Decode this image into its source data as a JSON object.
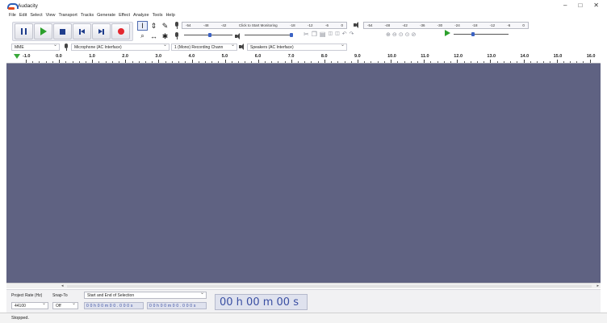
{
  "window": {
    "title": "Audacity",
    "controls": {
      "minimize": "–",
      "maximize": "□",
      "close": "✕"
    }
  },
  "menu": [
    "File",
    "Edit",
    "Select",
    "View",
    "Transport",
    "Tracks",
    "Generate",
    "Effect",
    "Analyze",
    "Tools",
    "Help"
  ],
  "transport": {
    "buttons": [
      "pause-icon",
      "play-icon",
      "stop-icon",
      "skip-to-start-icon",
      "skip-to-end-icon",
      "record-icon"
    ]
  },
  "tools": [
    {
      "name": "selection-tool",
      "glyph": "I"
    },
    {
      "name": "envelope-tool",
      "glyph": "⇕"
    },
    {
      "name": "draw-tool",
      "glyph": "✎"
    },
    {
      "name": "zoom-tool",
      "glyph": "🔍"
    },
    {
      "name": "time-shift-tool",
      "glyph": "↔"
    },
    {
      "name": "multi-tool",
      "glyph": "✱"
    }
  ],
  "record_meter": {
    "ticks": [
      "-54",
      "-48",
      "-42",
      "Click to Start Monitoring",
      "-18",
      "-12",
      "-6",
      "0"
    ]
  },
  "playback_meter": {
    "ticks": [
      "-54",
      "-48",
      "-42",
      "-36",
      "-30",
      "-24",
      "-18",
      "-12",
      "-6",
      "0"
    ]
  },
  "edit_toolbar": [
    "cut-icon",
    "copy-icon",
    "paste-icon",
    "trim-icon",
    "silence-icon",
    "undo-icon",
    "redo-icon"
  ],
  "zoom_toolbar": [
    "zoom-in-icon",
    "zoom-out-icon",
    "fit-selection-icon",
    "fit-project-icon",
    "zoom-toggle-icon"
  ],
  "devices": {
    "host": "MME",
    "recording_device": "Microphone (AC Interface)",
    "channels": "1 (Mono) Recording Chann",
    "playback_device": "Speakers (AC Interface)"
  },
  "ruler": {
    "labels": [
      "-1.0",
      "0.0",
      "1.0",
      "2.0",
      "3.0",
      "4.0",
      "5.0",
      "6.0",
      "7.0",
      "8.0",
      "9.0",
      "10.0",
      "11.0",
      "12.0",
      "13.0",
      "14.0",
      "15.0",
      "16.0"
    ]
  },
  "scroll": {
    "left": "◂",
    "right": "▸"
  },
  "bottom": {
    "project_rate_label": "Project Rate (Hz)",
    "project_rate_value": "44100",
    "snap_to_label": "Snap-To",
    "snap_to_value": "Off",
    "selection_label": "Start and End of Selection",
    "selection_start": "0 0 h 0 0 m 0 0 . 0 0 0 s",
    "selection_end": "0 0 h 0 0 m 0 0 . 0 0 0 s",
    "audio_position": "00 h 00 m 00 s"
  },
  "status": "Stopped."
}
